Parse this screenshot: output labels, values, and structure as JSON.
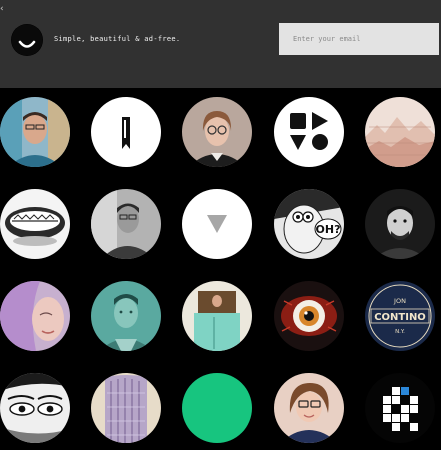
{
  "header": {
    "back_glyph": "‹",
    "logo_icon": "smile-circle-icon",
    "tagline": "Simple, beautiful & ad-free.",
    "email_placeholder": "Enter your email"
  },
  "avatars": [
    {
      "name": "avatar-man-blue-shirt",
      "color": "#2c6f8c"
    },
    {
      "name": "avatar-bookmark-logo",
      "color": "#ffffff"
    },
    {
      "name": "avatar-woman-glasses",
      "color": "#8e6e60"
    },
    {
      "name": "avatar-shapes-logo",
      "color": "#ffffff"
    },
    {
      "name": "avatar-sketch-landscape",
      "color": "#e4c4b8"
    },
    {
      "name": "avatar-cartoon-creature",
      "color": "#e8e8e8"
    },
    {
      "name": "avatar-man-bw",
      "color": "#8a8a8a"
    },
    {
      "name": "avatar-triangle-logo",
      "color": "#ffffff"
    },
    {
      "name": "avatar-oh-illustration",
      "color": "#d8d8d8"
    },
    {
      "name": "avatar-man-dark",
      "color": "#2a2a2a"
    },
    {
      "name": "avatar-purple-hair",
      "color": "#c9a3d6"
    },
    {
      "name": "avatar-teal-portrait",
      "color": "#5aa9a0"
    },
    {
      "name": "avatar-door-teal",
      "color": "#7fd3c4"
    },
    {
      "name": "avatar-eyeball-illustration",
      "color": "#2a1a18"
    },
    {
      "name": "avatar-contino-badge",
      "color": "#1b2a4a"
    },
    {
      "name": "avatar-eyes-drawing",
      "color": "#cfcfcf"
    },
    {
      "name": "avatar-braided-hair",
      "color": "#b6a6c8"
    },
    {
      "name": "avatar-green-circle",
      "color": "#17c57f"
    },
    {
      "name": "avatar-woman-glasses-2",
      "color": "#c89a82"
    },
    {
      "name": "avatar-grid-logo",
      "color": "#0b0b0b"
    }
  ],
  "badge_text": {
    "top": "JON",
    "main": "CONTINO",
    "bottom": "N.Y."
  },
  "illustration_text": "OH?"
}
